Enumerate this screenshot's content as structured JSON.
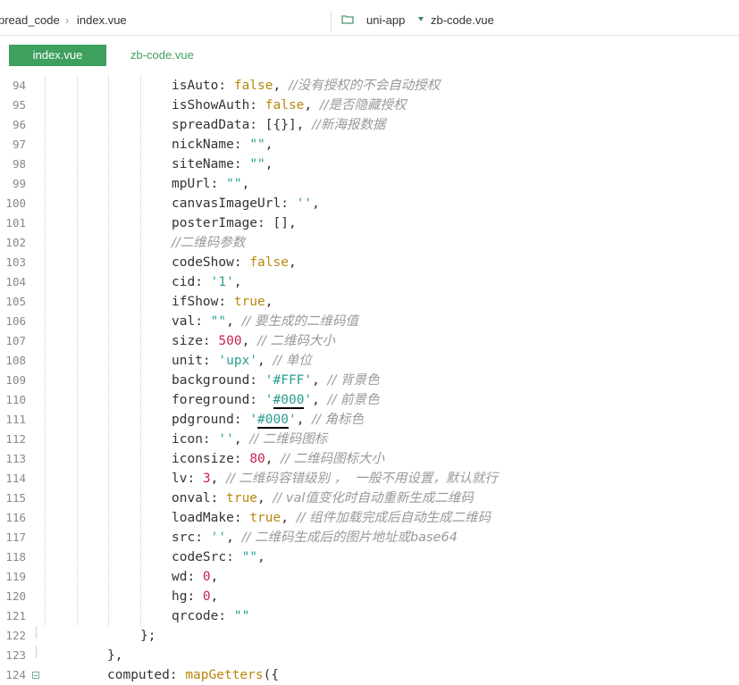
{
  "breadcrumb": {
    "left_path": "pread_code",
    "left_file": "index.vue",
    "project": "uni-app",
    "right_file": "zb-code.vue"
  },
  "tabs": [
    {
      "label": "index.vue",
      "active": true
    },
    {
      "label": "zb-code.vue",
      "active": false
    }
  ],
  "colors": {
    "accent": "#3f9f5f",
    "keyword": "#b8860b",
    "string": "#2a9d8f",
    "number": "#c7254e",
    "comment": "#999999"
  },
  "lines": [
    {
      "n": "94",
      "t": [
        [
          "k",
          "isAuto: "
        ],
        [
          "kw",
          "false"
        ],
        [
          "p",
          ", "
        ],
        [
          "cm",
          "//没有授权的不会自动授权"
        ]
      ]
    },
    {
      "n": "95",
      "t": [
        [
          "k",
          "isShowAuth: "
        ],
        [
          "kw",
          "false"
        ],
        [
          "p",
          ", "
        ],
        [
          "cm",
          "//是否隐藏授权"
        ]
      ]
    },
    {
      "n": "96",
      "t": [
        [
          "k",
          "spreadData: [{}], "
        ],
        [
          "cm",
          "//新海报数据"
        ]
      ]
    },
    {
      "n": "97",
      "t": [
        [
          "k",
          "nickName: "
        ],
        [
          "str",
          "\"\""
        ],
        [
          "p",
          ","
        ]
      ]
    },
    {
      "n": "98",
      "t": [
        [
          "k",
          "siteName: "
        ],
        [
          "str",
          "\"\""
        ],
        [
          "p",
          ","
        ]
      ]
    },
    {
      "n": "99",
      "t": [
        [
          "k",
          "mpUrl: "
        ],
        [
          "str",
          "\"\""
        ],
        [
          "p",
          ","
        ]
      ]
    },
    {
      "n": "100",
      "t": [
        [
          "k",
          "canvasImageUrl: "
        ],
        [
          "str",
          "''"
        ],
        [
          "p",
          ","
        ]
      ]
    },
    {
      "n": "101",
      "t": [
        [
          "k",
          "posterImage: [],"
        ]
      ]
    },
    {
      "n": "102",
      "t": [
        [
          "cm",
          "//二维码参数"
        ]
      ]
    },
    {
      "n": "103",
      "t": [
        [
          "k",
          "codeShow: "
        ],
        [
          "kw",
          "false"
        ],
        [
          "p",
          ","
        ]
      ]
    },
    {
      "n": "104",
      "t": [
        [
          "k",
          "cid: "
        ],
        [
          "str",
          "'1'"
        ],
        [
          "p",
          ","
        ]
      ]
    },
    {
      "n": "105",
      "t": [
        [
          "k",
          "ifShow: "
        ],
        [
          "kw",
          "true"
        ],
        [
          "p",
          ","
        ]
      ]
    },
    {
      "n": "106",
      "t": [
        [
          "k",
          "val: "
        ],
        [
          "str",
          "\"\""
        ],
        [
          "p",
          ", "
        ],
        [
          "cm",
          "// 要生成的二维码值"
        ]
      ]
    },
    {
      "n": "107",
      "t": [
        [
          "k",
          "size: "
        ],
        [
          "num",
          "500"
        ],
        [
          "p",
          ", "
        ],
        [
          "cm",
          "// 二维码大小"
        ]
      ]
    },
    {
      "n": "108",
      "t": [
        [
          "k",
          "unit: "
        ],
        [
          "str",
          "'upx'"
        ],
        [
          "p",
          ", "
        ],
        [
          "cm",
          "// 单位"
        ]
      ]
    },
    {
      "n": "109",
      "t": [
        [
          "k",
          "background: "
        ],
        [
          "str",
          "'#FFF'"
        ],
        [
          "p",
          ", "
        ],
        [
          "cm",
          "// 背景色"
        ]
      ]
    },
    {
      "n": "110",
      "t": [
        [
          "k",
          "foreground: "
        ],
        [
          "str",
          "'"
        ],
        [
          "strm",
          "#000"
        ],
        [
          "str",
          "'"
        ],
        [
          "p",
          ", "
        ],
        [
          "cm",
          "// 前景色"
        ]
      ]
    },
    {
      "n": "111",
      "t": [
        [
          "k",
          "pdground: "
        ],
        [
          "str",
          "'"
        ],
        [
          "strm",
          "#000"
        ],
        [
          "str",
          "'"
        ],
        [
          "p",
          ", "
        ],
        [
          "cm",
          "// 角标色"
        ]
      ]
    },
    {
      "n": "112",
      "t": [
        [
          "k",
          "icon: "
        ],
        [
          "str",
          "''"
        ],
        [
          "p",
          ", "
        ],
        [
          "cm",
          "// 二维码图标"
        ]
      ]
    },
    {
      "n": "113",
      "t": [
        [
          "k",
          "iconsize: "
        ],
        [
          "num",
          "80"
        ],
        [
          "p",
          ", "
        ],
        [
          "cm",
          "// 二维码图标大小"
        ]
      ]
    },
    {
      "n": "114",
      "t": [
        [
          "k",
          "lv: "
        ],
        [
          "num",
          "3"
        ],
        [
          "p",
          ", "
        ],
        [
          "cm",
          "// 二维码容错级别 ，  一般不用设置，默认就行"
        ]
      ]
    },
    {
      "n": "115",
      "t": [
        [
          "k",
          "onval: "
        ],
        [
          "kw",
          "true"
        ],
        [
          "p",
          ", "
        ],
        [
          "cm",
          "// val值变化时自动重新生成二维码"
        ]
      ]
    },
    {
      "n": "116",
      "t": [
        [
          "k",
          "loadMake: "
        ],
        [
          "kw",
          "true"
        ],
        [
          "p",
          ", "
        ],
        [
          "cm",
          "// 组件加载完成后自动生成二维码"
        ]
      ]
    },
    {
      "n": "117",
      "t": [
        [
          "k",
          "src: "
        ],
        [
          "str",
          "''"
        ],
        [
          "p",
          ", "
        ],
        [
          "cm",
          "// 二维码生成后的图片地址或base64"
        ]
      ]
    },
    {
      "n": "118",
      "t": [
        [
          "k",
          "codeSrc: "
        ],
        [
          "str",
          "\"\""
        ],
        [
          "p",
          ","
        ]
      ]
    },
    {
      "n": "119",
      "t": [
        [
          "k",
          "wd: "
        ],
        [
          "num",
          "0"
        ],
        [
          "p",
          ","
        ]
      ]
    },
    {
      "n": "120",
      "t": [
        [
          "k",
          "hg: "
        ],
        [
          "num",
          "0"
        ],
        [
          "p",
          ","
        ]
      ]
    },
    {
      "n": "121",
      "t": [
        [
          "k",
          "qrcode: "
        ],
        [
          "str",
          "\"\""
        ]
      ]
    },
    {
      "n": "122",
      "t": [
        [
          "k",
          "};"
        ]
      ]
    },
    {
      "n": "123",
      "t": [
        [
          "k",
          "},"
        ]
      ]
    },
    {
      "n": "124",
      "t": [
        [
          "k",
          "computed: "
        ],
        [
          "fn",
          "mapGetters"
        ],
        [
          "p",
          "({"
        ]
      ]
    }
  ]
}
